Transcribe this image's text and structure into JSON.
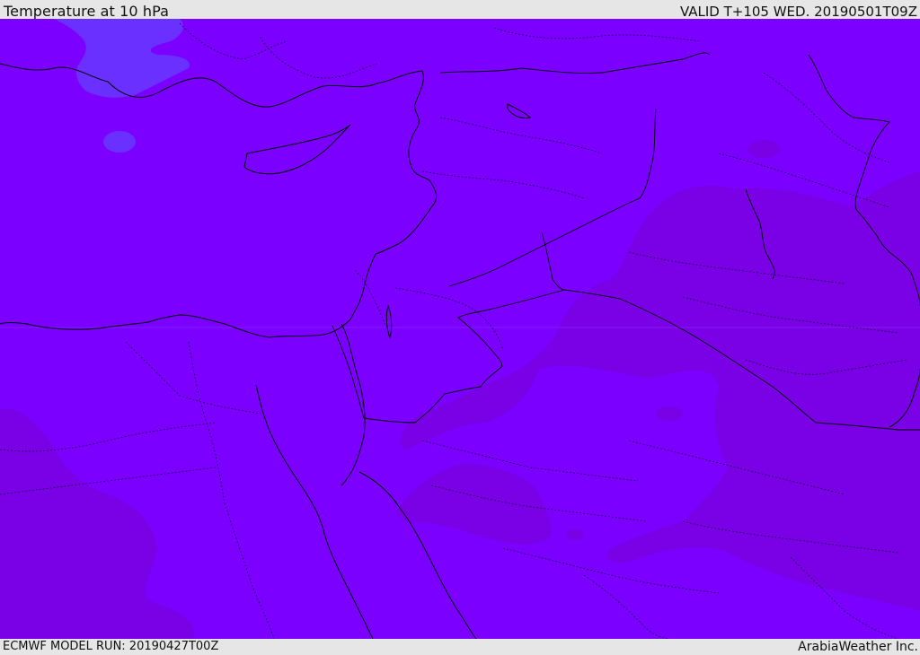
{
  "header": {
    "title": "Temperature at 10 hPa",
    "valid": "VALID T+105 WED. 20190501T09Z"
  },
  "footer": {
    "model_run": "ECMWF MODEL RUN: 20190427T00Z",
    "credit": "ArabiaWeather Inc."
  },
  "map": {
    "parameter": "Temperature",
    "level": "10 hPa",
    "colors": {
      "field_main": "#7b00ff",
      "field_warm": "#7a00e6",
      "field_cool": "#6a30ff",
      "coastline": "#000000",
      "border": "#1a0033"
    }
  }
}
